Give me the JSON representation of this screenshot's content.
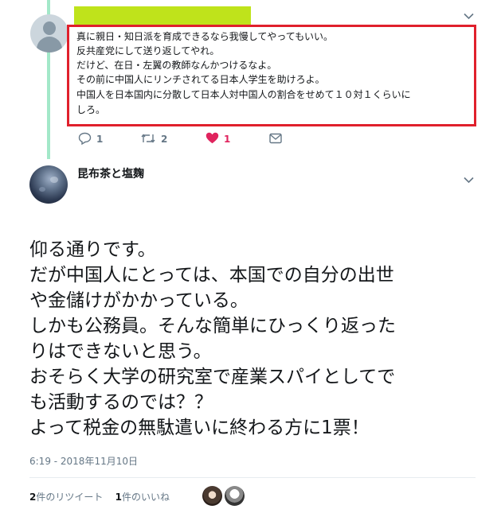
{
  "reply_tweet": {
    "lines": [
      "真に親日・知日派を育成できるなら我慢してやってもいい。",
      "反共産党にして送り返してやれ。",
      "だけど、在日・左翼の教師なんかつけるなよ。",
      "その前に中国人にリンチされてる日本人学生を助けろよ。",
      "中国人を日本国内に分散して日本人対中国人の割合をせめて１０対１くらいに",
      "しろ。"
    ],
    "actions": {
      "reply_count": "1",
      "retweet_count": "2",
      "like_count": "1"
    }
  },
  "main_tweet": {
    "display_name": "昆布茶と塩麹",
    "lines": [
      "仰る通りです。",
      "だが中国人にとっては、本国での自分の出世",
      "や金儲けがかかっている。",
      "しかも公務員。そんな簡単にひっくり返った",
      "りはできないと思う。",
      "おそらく大学の研究室で産業スパイとしてで",
      "も活動するのでは？？",
      "よって税金の無駄遣いに終わる方に1票！"
    ],
    "timestamp": "6:19 - 2018年11月10日",
    "retweet_count": "2",
    "retweet_label": "件のリツイート",
    "like_count": "1",
    "like_label": "件のいいね"
  },
  "icons": {
    "menu": "chevron-down-icon",
    "reply": "reply-bubble-icon",
    "retweet": "retweet-icon",
    "like": "heart-icon",
    "dm": "envelope-icon"
  },
  "colors": {
    "thread_line": "#a3e8c9",
    "highlight_border": "#e0202c",
    "redaction_bar": "#bfe31b",
    "like": "#e0245e",
    "muted_text": "#657786"
  }
}
